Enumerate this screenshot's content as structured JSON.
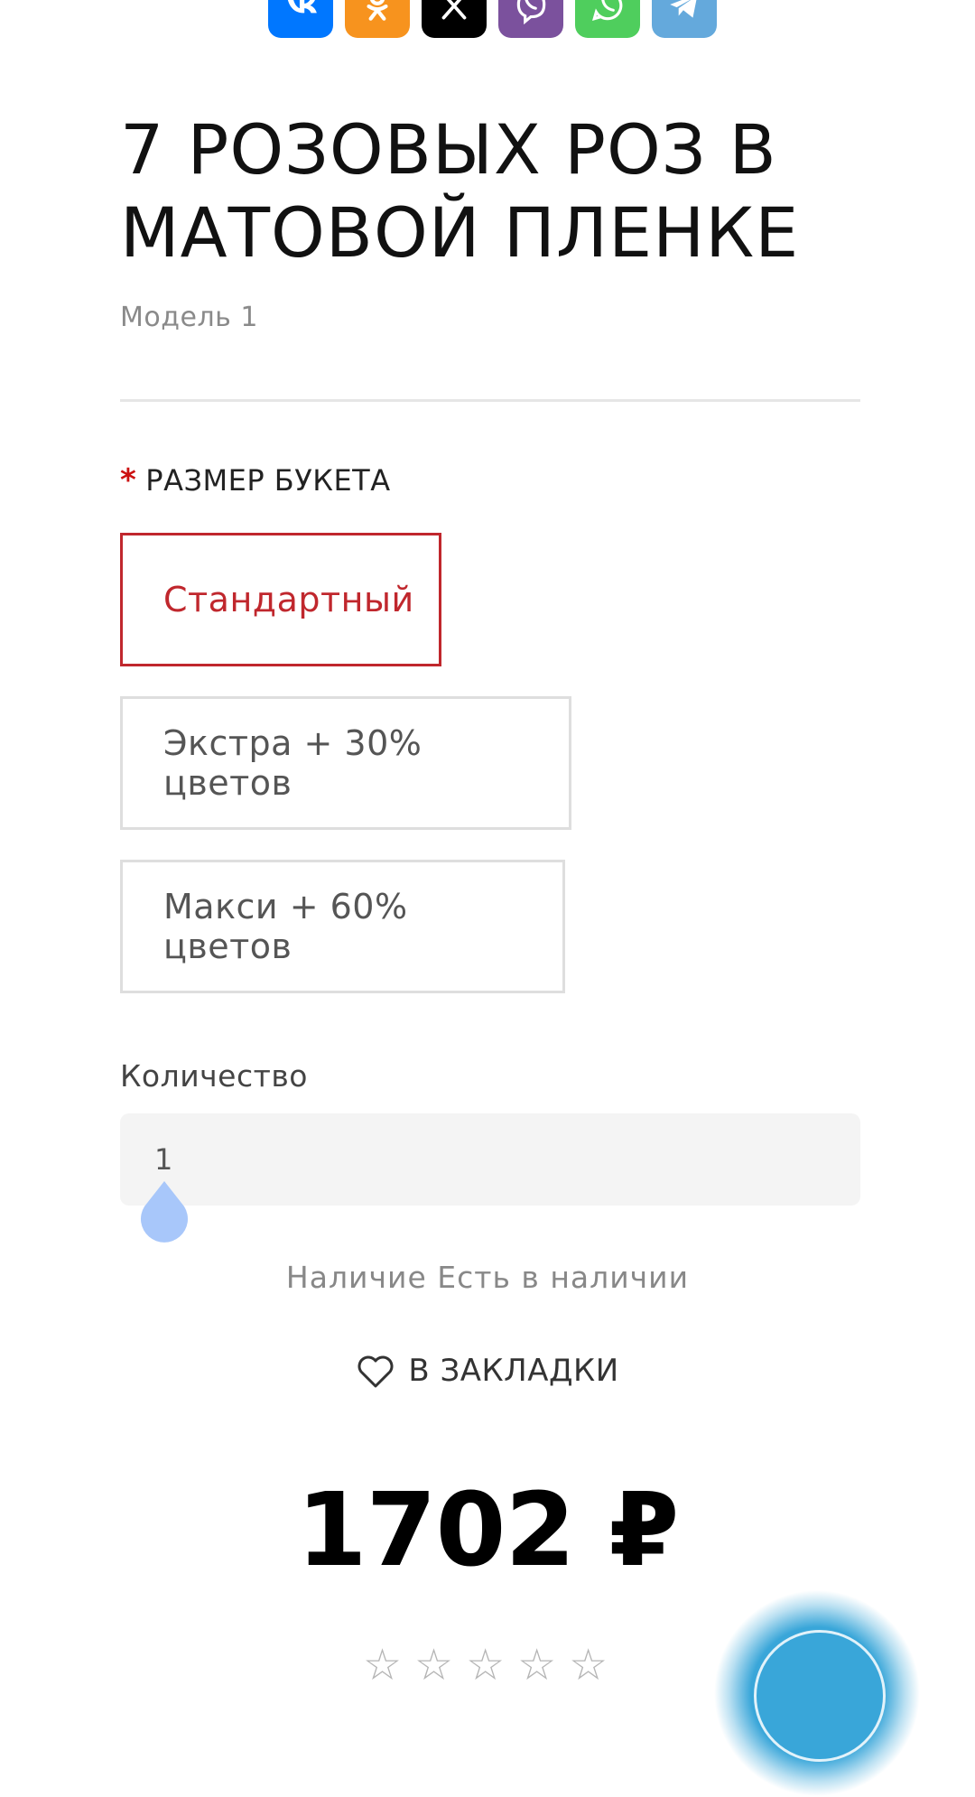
{
  "share": {
    "buttons": [
      {
        "name": "vk",
        "color": "#0077ff"
      },
      {
        "name": "odnoklassniki",
        "color": "#f7931e"
      },
      {
        "name": "x",
        "color": "#000000"
      },
      {
        "name": "viber",
        "color": "#7b519d"
      },
      {
        "name": "whatsapp",
        "color": "#4fce5d"
      },
      {
        "name": "telegram",
        "color": "#64a9dc"
      }
    ]
  },
  "product": {
    "title": "7 РОЗОВЫХ РОЗ В МАТОВОЙ ПЛЕНКЕ",
    "model": "Модель 1"
  },
  "options": {
    "required_mark": "*",
    "label": "РАЗМЕР БУКЕТА",
    "items": [
      {
        "label": "Стандартный",
        "selected": true
      },
      {
        "label": "Экстра + 30% цветов",
        "selected": false
      },
      {
        "label": "Макси + 60% цветов",
        "selected": false
      }
    ]
  },
  "quantity": {
    "label": "Количество",
    "value": "1"
  },
  "stock": {
    "text": "Наличие Есть в наличии"
  },
  "wishlist": {
    "label": "В ЗАКЛАДКИ",
    "icon": "heart-icon"
  },
  "price": {
    "text": "1702 ₽"
  },
  "rating": {
    "stars": 0,
    "max": 5
  },
  "colors": {
    "accent": "#c0272d",
    "required": "#cc1111",
    "chat": "#39a6d9"
  }
}
